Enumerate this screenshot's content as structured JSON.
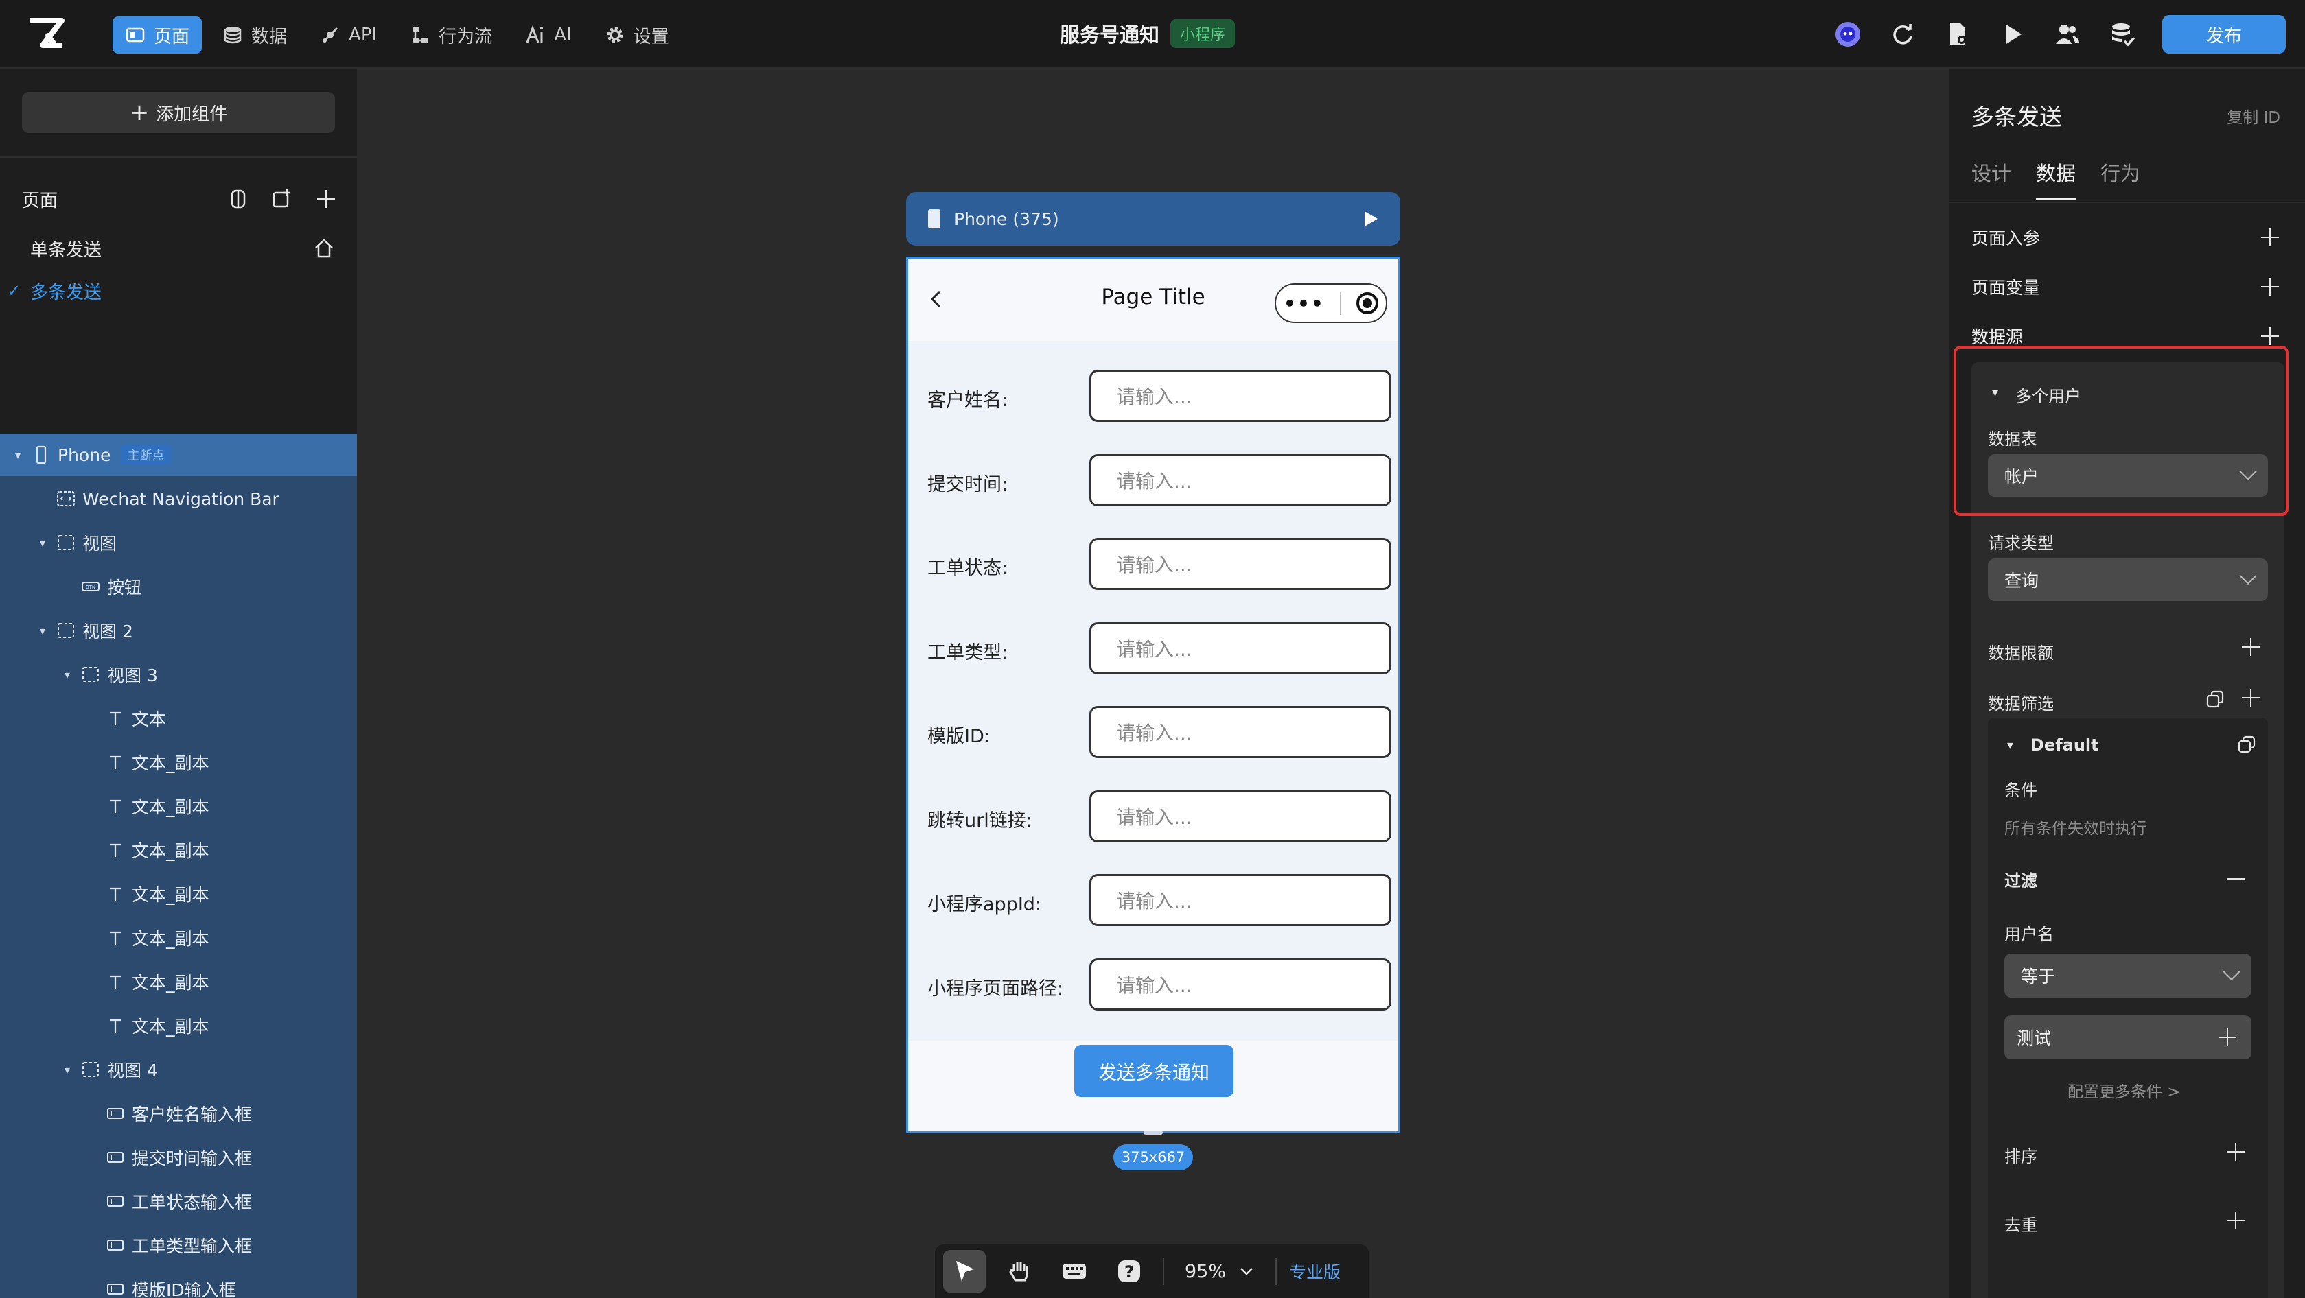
{
  "topbar": {
    "nav": [
      {
        "label": "页面",
        "icon": "page-icon",
        "active": true
      },
      {
        "label": "数据",
        "icon": "database-icon",
        "active": false
      },
      {
        "label": "API",
        "icon": "api-icon",
        "active": false
      },
      {
        "label": "行为流",
        "icon": "flow-icon",
        "active": false
      },
      {
        "label": "AI",
        "icon": "ai-icon",
        "active": false
      },
      {
        "label": "设置",
        "icon": "gear-icon",
        "active": false
      }
    ],
    "doc_title": "服务号通知",
    "doc_badge": "小程序",
    "publish_label": "发布",
    "accent": "#3a8ee6"
  },
  "left": {
    "add_component": "添加组件",
    "pages_label": "页面",
    "pages": [
      {
        "label": "单条发送",
        "selected": false
      },
      {
        "label": "多条发送",
        "selected": true
      }
    ],
    "tree": [
      {
        "label": "Phone",
        "badge": "主断点",
        "depth": 0,
        "caret": "▾",
        "icon": "phone-icon"
      },
      {
        "label": "Wechat Navigation Bar",
        "depth": 1,
        "caret": "",
        "icon": "navbar-icon"
      },
      {
        "label": "视图",
        "depth": 1,
        "caret": "▾",
        "icon": "view-icon"
      },
      {
        "label": "按钮",
        "depth": 2,
        "caret": "",
        "icon": "button-icon"
      },
      {
        "label": "视图 2",
        "depth": 1,
        "caret": "▾",
        "icon": "view-icon"
      },
      {
        "label": "视图 3",
        "depth": 2,
        "caret": "▾",
        "icon": "view-icon"
      },
      {
        "label": "文本",
        "depth": 3,
        "caret": "",
        "icon": "text-icon"
      },
      {
        "label": "文本_副本",
        "depth": 3,
        "caret": "",
        "icon": "text-icon"
      },
      {
        "label": "文本_副本",
        "depth": 3,
        "caret": "",
        "icon": "text-icon"
      },
      {
        "label": "文本_副本",
        "depth": 3,
        "caret": "",
        "icon": "text-icon"
      },
      {
        "label": "文本_副本",
        "depth": 3,
        "caret": "",
        "icon": "text-icon"
      },
      {
        "label": "文本_副本",
        "depth": 3,
        "caret": "",
        "icon": "text-icon"
      },
      {
        "label": "文本_副本",
        "depth": 3,
        "caret": "",
        "icon": "text-icon"
      },
      {
        "label": "文本_副本",
        "depth": 3,
        "caret": "",
        "icon": "text-icon"
      },
      {
        "label": "视图 4",
        "depth": 2,
        "caret": "▾",
        "icon": "view-icon"
      },
      {
        "label": "客户姓名输入框",
        "depth": 3,
        "caret": "",
        "icon": "input-icon"
      },
      {
        "label": "提交时间输入框",
        "depth": 3,
        "caret": "",
        "icon": "input-icon"
      },
      {
        "label": "工单状态输入框",
        "depth": 3,
        "caret": "",
        "icon": "input-icon"
      },
      {
        "label": "工单类型输入框",
        "depth": 3,
        "caret": "",
        "icon": "input-icon"
      },
      {
        "label": "模版ID输入框",
        "depth": 3,
        "caret": "",
        "icon": "input-icon"
      }
    ]
  },
  "canvas": {
    "device_label": "Phone (375)",
    "page_title": "Page Title",
    "form": [
      {
        "label": "客户姓名:",
        "placeholder": "请输入..."
      },
      {
        "label": "提交时间:",
        "placeholder": "请输入..."
      },
      {
        "label": "工单状态:",
        "placeholder": "请输入..."
      },
      {
        "label": "工单类型:",
        "placeholder": "请输入..."
      },
      {
        "label": "模版ID:",
        "placeholder": "请输入..."
      },
      {
        "label": "跳转url链接:",
        "placeholder": "请输入..."
      },
      {
        "label": "小程序appId:",
        "placeholder": "请输入..."
      },
      {
        "label": "小程序页面路径:",
        "placeholder": "请输入..."
      }
    ],
    "send_button": "发送多条通知",
    "size_badge": "375x667",
    "zoom": "95%",
    "edition": "专业版"
  },
  "right": {
    "title": "多条发送",
    "copy_id": "复制 ID",
    "tabs": [
      {
        "label": "设计",
        "active": false
      },
      {
        "label": "数据",
        "active": true
      },
      {
        "label": "行为",
        "active": false
      }
    ],
    "page_params": "页面入参",
    "page_vars": "页面变量",
    "datasource": "数据源",
    "ds_name": "多个用户",
    "table_label": "数据表",
    "table_value": "帐户",
    "req_type_label": "请求类型",
    "req_type_value": "查询",
    "limit_label": "数据限额",
    "filter_label": "数据筛选",
    "filter_default": "Default",
    "condition_label": "条件",
    "condition_hint": "所有条件失效时执行",
    "filter_sub": "过滤",
    "field_label": "用户名",
    "operator_value": "等于",
    "value_text": "测试",
    "more_conditions": "配置更多条件 >",
    "sort_label": "排序",
    "dedupe_label": "去重",
    "highlight_color": "#e03434"
  }
}
